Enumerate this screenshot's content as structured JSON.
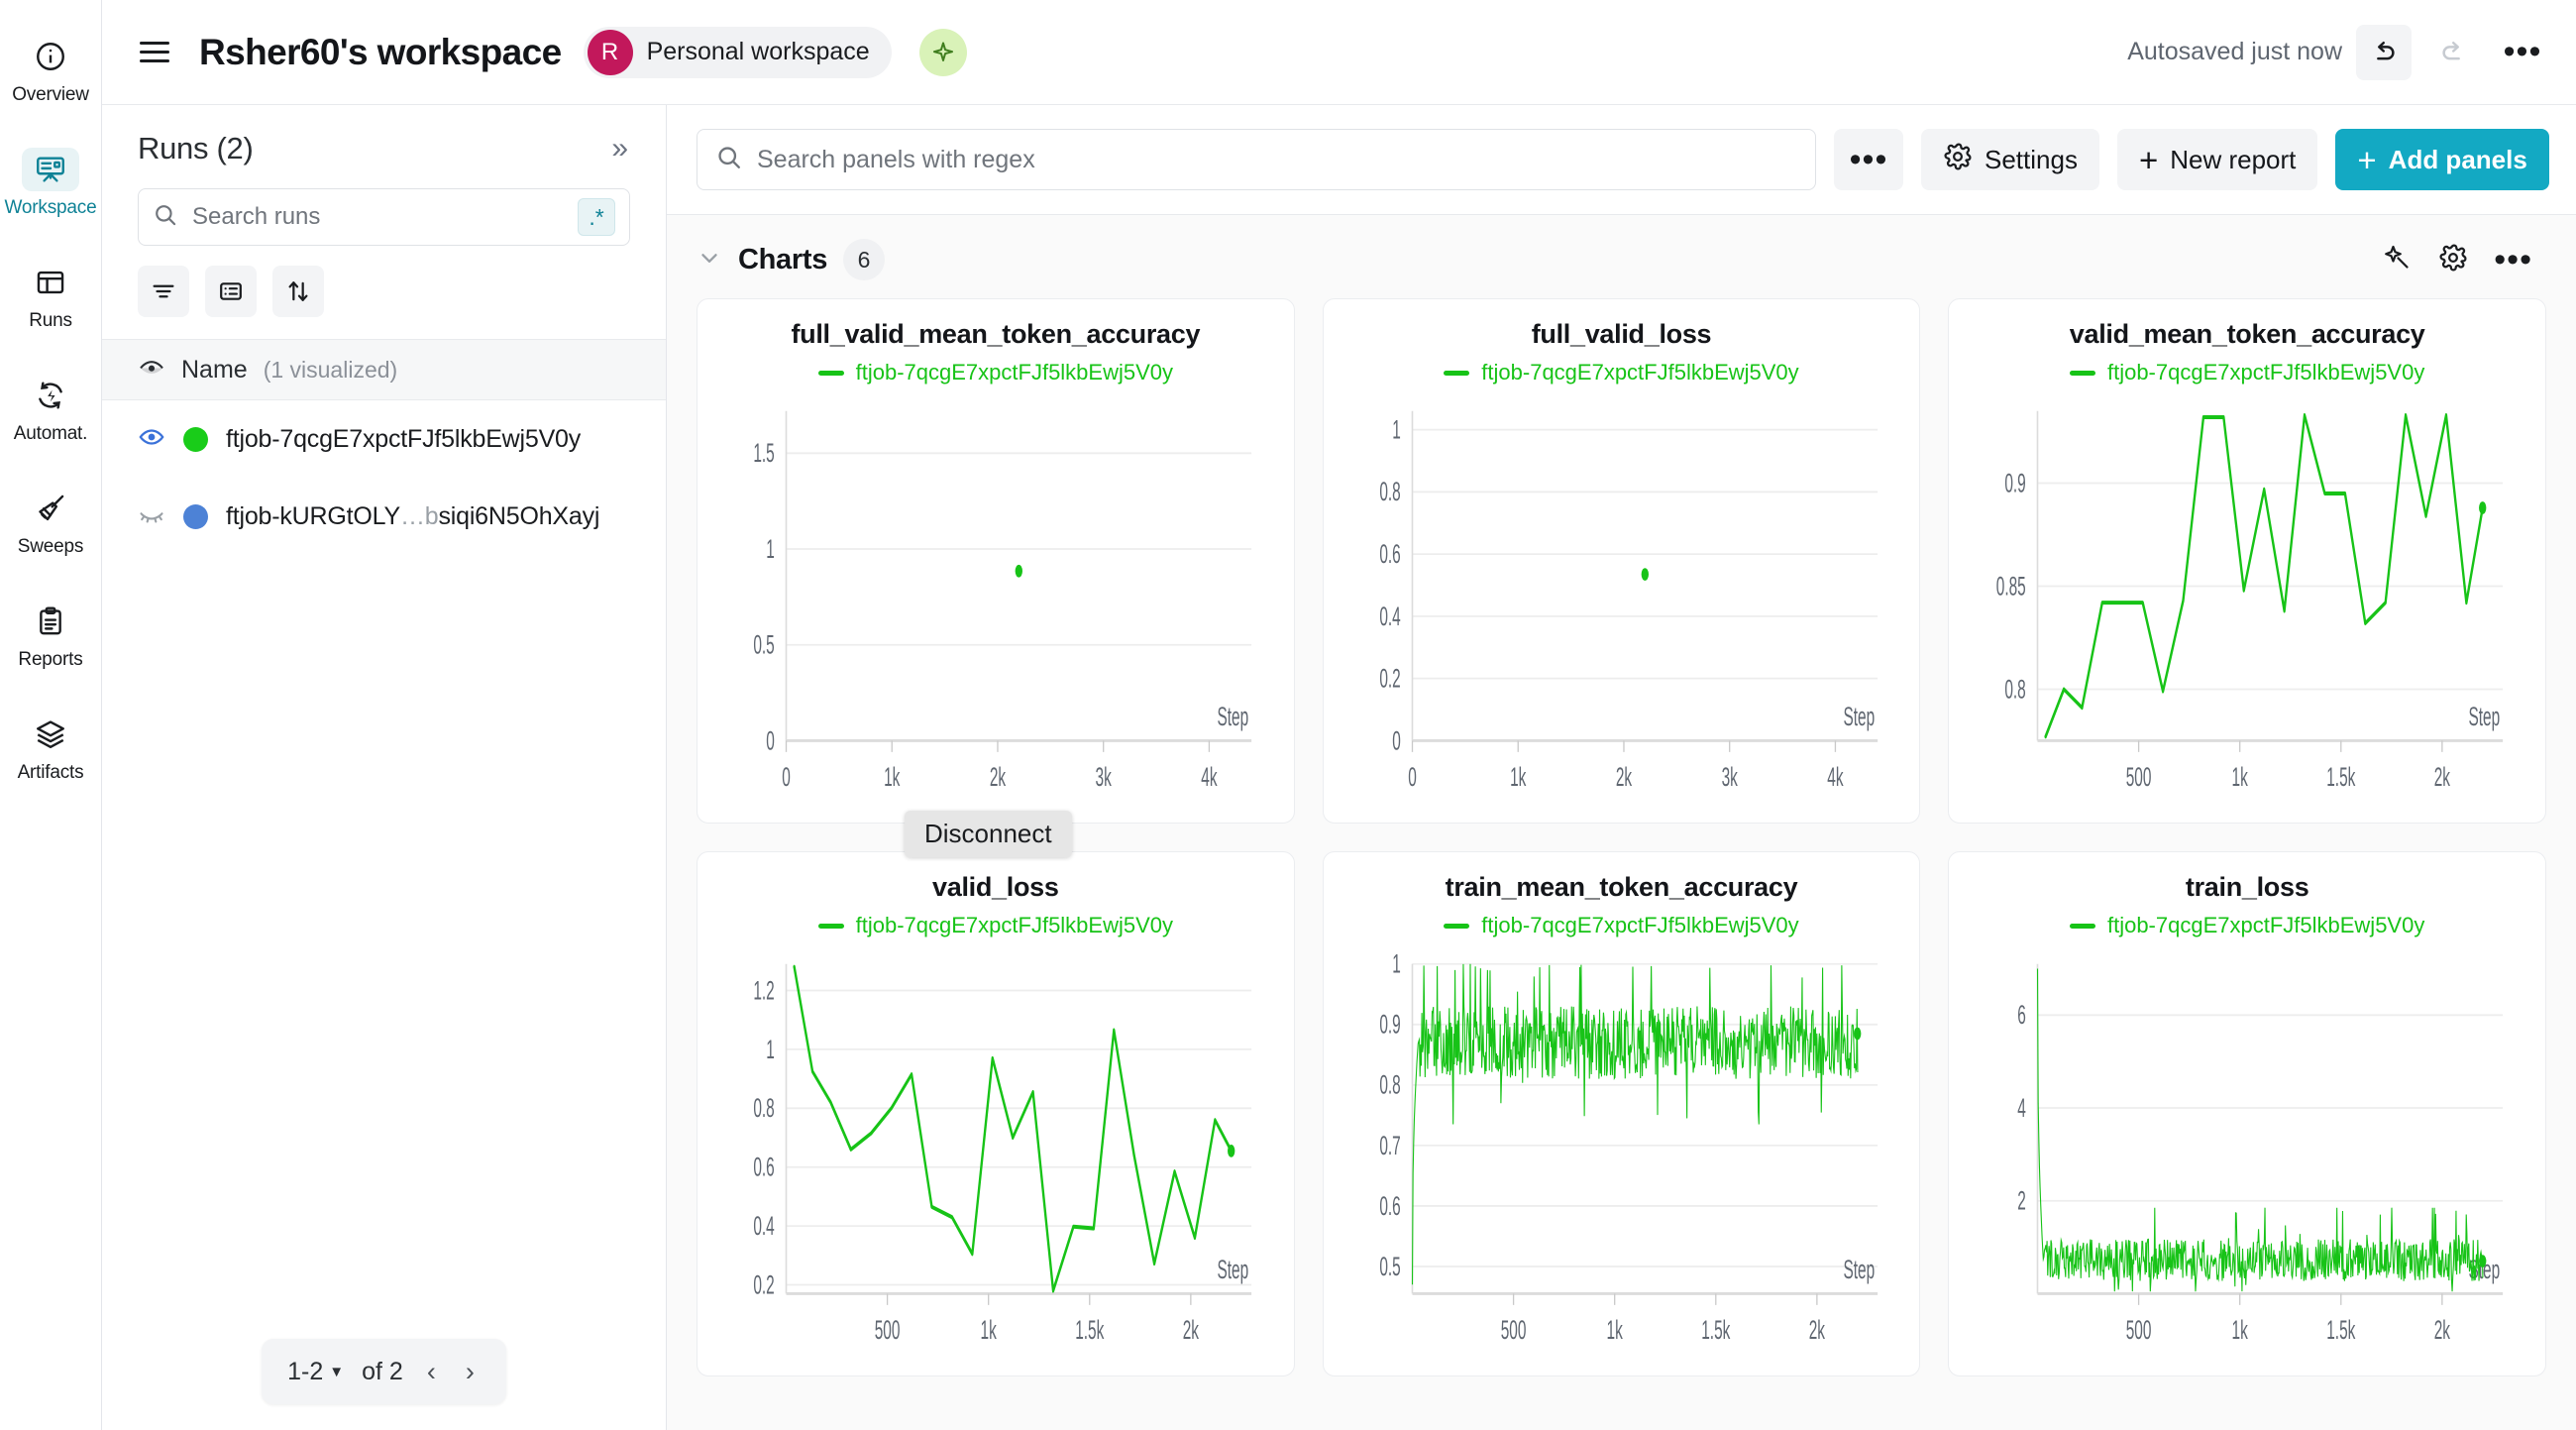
{
  "rail": {
    "items": [
      {
        "label": "Overview",
        "icon": "info-circle-icon",
        "active": false
      },
      {
        "label": "Workspace",
        "icon": "workspace-board-icon",
        "active": true
      },
      {
        "label": "Runs",
        "icon": "table-icon",
        "active": false
      },
      {
        "label": "Automat.",
        "icon": "automation-icon",
        "active": false
      },
      {
        "label": "Sweeps",
        "icon": "broom-icon",
        "active": false
      },
      {
        "label": "Reports",
        "icon": "clipboard-icon",
        "active": false
      },
      {
        "label": "Artifacts",
        "icon": "layers-icon",
        "active": false
      }
    ]
  },
  "topbar": {
    "title": "Rsher60's workspace",
    "avatar_initial": "R",
    "workspace_chip": "Personal workspace",
    "autosaved": "Autosaved just now",
    "accent_color": "#13a9c3",
    "avatar_color": "#c2185b"
  },
  "runs_panel": {
    "title": "Runs (2)",
    "collapse_label": "»",
    "search_placeholder": "Search runs",
    "regex_chip": ".*",
    "column_header": {
      "name": "Name",
      "visualized": "(1 visualized)"
    },
    "runs": [
      {
        "name": "ftjob-7qcgE7xpctFJf5lkbEwj5V0y",
        "color": "#19cc19",
        "visible": true
      },
      {
        "name": "ftjob-kURGtOLY",
        "name_dim": "…b",
        "name_tail": "siqi6N5OhXayj",
        "color": "#4d82d6",
        "visible": false
      }
    ],
    "pager": {
      "range": "1-2",
      "of": "of 2",
      "prev": "‹",
      "next": "›"
    }
  },
  "panel_toolbar": {
    "search_placeholder": "Search panels with regex",
    "more_label": "•••",
    "settings_label": "Settings",
    "new_report_label": "New report",
    "add_panels_label": "Add panels"
  },
  "section": {
    "title": "Charts",
    "count": "6",
    "chevron": "⌄"
  },
  "tooltip": {
    "text": "Disconnect"
  },
  "chart_data": [
    {
      "type": "scatter",
      "title": "full_valid_mean_token_accuracy",
      "legend": [
        "ftjob-7qcgE7xpctFJf5lkbEwj5V0y"
      ],
      "series_color": "#17c317",
      "xlabel": "Step",
      "ylabel": "",
      "xticks": [
        "0",
        "1k",
        "2k",
        "3k",
        "4k"
      ],
      "xtick_values": [
        0,
        1000,
        2000,
        3000,
        4000
      ],
      "yticks": [
        "0",
        "0.5",
        "1",
        "1.5"
      ],
      "ytick_values": [
        0,
        0.5,
        1,
        1.5
      ],
      "xlim": [
        0,
        4400
      ],
      "ylim": [
        0,
        1.72
      ],
      "grid": true,
      "points": [
        [
          2200,
          0.885
        ]
      ]
    },
    {
      "type": "scatter",
      "title": "full_valid_loss",
      "legend": [
        "ftjob-7qcgE7xpctFJf5lkbEwj5V0y"
      ],
      "series_color": "#17c317",
      "xlabel": "Step",
      "ylabel": "",
      "xticks": [
        "0",
        "1k",
        "2k",
        "3k",
        "4k"
      ],
      "xtick_values": [
        0,
        1000,
        2000,
        3000,
        4000
      ],
      "yticks": [
        "0",
        "0.2",
        "0.4",
        "0.6",
        "0.8",
        "1"
      ],
      "ytick_values": [
        0,
        0.2,
        0.4,
        0.6,
        0.8,
        1
      ],
      "xlim": [
        0,
        4400
      ],
      "ylim": [
        0,
        1.06
      ],
      "grid": true,
      "points": [
        [
          2200,
          0.535
        ]
      ]
    },
    {
      "type": "line",
      "title": "valid_mean_token_accuracy",
      "legend": [
        "ftjob-7qcgE7xpctFJf5lkbEwj5V0y"
      ],
      "series_color": "#17c317",
      "xlabel": "Step",
      "ylabel": "",
      "xticks": [
        "500",
        "1k",
        "1.5k",
        "2k"
      ],
      "xtick_values": [
        500,
        1000,
        1500,
        2000
      ],
      "yticks": [
        "0.8",
        "0.85",
        "0.9"
      ],
      "ytick_values": [
        0.8,
        0.85,
        0.9
      ],
      "xlim": [
        0,
        2300
      ],
      "ylim": [
        0.775,
        0.935
      ],
      "grid": true,
      "x": [
        40,
        130,
        220,
        320,
        420,
        520,
        620,
        720,
        820,
        920,
        1020,
        1120,
        1220,
        1320,
        1420,
        1520,
        1620,
        1720,
        1820,
        1920,
        2020,
        2120,
        2200
      ],
      "values": [
        0.777,
        0.8,
        0.791,
        0.842,
        0.842,
        0.842,
        0.799,
        0.843,
        0.932,
        0.932,
        0.848,
        0.897,
        0.838,
        0.933,
        0.895,
        0.895,
        0.832,
        0.842,
        0.933,
        0.884,
        0.933,
        0.842,
        0.888
      ],
      "endpoint": [
        2200,
        0.888
      ]
    },
    {
      "type": "line",
      "title": "valid_loss",
      "legend": [
        "ftjob-7qcgE7xpctFJf5lkbEwj5V0y"
      ],
      "series_color": "#17c317",
      "xlabel": "Step",
      "ylabel": "",
      "xticks": [
        "500",
        "1k",
        "1.5k",
        "2k"
      ],
      "xtick_values": [
        500,
        1000,
        1500,
        2000
      ],
      "yticks": [
        "0.2",
        "0.4",
        "0.6",
        "0.8",
        "1",
        "1.2"
      ],
      "ytick_values": [
        0.2,
        0.4,
        0.6,
        0.8,
        1.0,
        1.2
      ],
      "xlim": [
        0,
        2300
      ],
      "ylim": [
        0.17,
        1.29
      ],
      "grid": true,
      "x": [
        40,
        130,
        220,
        320,
        420,
        520,
        620,
        720,
        820,
        920,
        1020,
        1120,
        1220,
        1320,
        1420,
        1520,
        1620,
        1720,
        1820,
        1920,
        2020,
        2120,
        2200
      ],
      "values": [
        1.28,
        0.925,
        0.82,
        0.66,
        0.715,
        0.8,
        0.915,
        0.465,
        0.43,
        0.305,
        0.97,
        0.7,
        0.855,
        0.18,
        0.398,
        0.392,
        1.065,
        0.64,
        0.272,
        0.585,
        0.36,
        0.76,
        0.655
      ],
      "endpoint": [
        2200,
        0.655
      ]
    },
    {
      "type": "line",
      "title": "train_mean_token_accuracy",
      "legend": [
        "ftjob-7qcgE7xpctFJf5lkbEwj5V0y"
      ],
      "series_color": "#17c317",
      "xlabel": "Step",
      "ylabel": "",
      "xticks": [
        "500",
        "1k",
        "1.5k",
        "2k"
      ],
      "xtick_values": [
        500,
        1000,
        1500,
        2000
      ],
      "yticks": [
        "0.5",
        "0.6",
        "0.7",
        "0.8",
        "0.9",
        "1"
      ],
      "ytick_values": [
        0.5,
        0.6,
        0.7,
        0.8,
        0.9,
        1
      ],
      "xlim": [
        0,
        2300
      ],
      "ylim": [
        0.455,
        1.0
      ],
      "grid": true,
      "noise_band": {
        "start_value": 0.47,
        "rise_end_step": 30,
        "mean": 0.87,
        "min": 0.735,
        "max": 1.0,
        "samples": 700
      },
      "endpoint": [
        2200,
        0.885
      ]
    },
    {
      "type": "line",
      "title": "train_loss",
      "legend": [
        "ftjob-7qcgE7xpctFJf5lkbEwj5V0y"
      ],
      "series_color": "#17c317",
      "xlabel": "Step",
      "ylabel": "",
      "xticks": [
        "500",
        "1k",
        "1.5k",
        "2k"
      ],
      "xtick_values": [
        500,
        1000,
        1500,
        2000
      ],
      "yticks": [
        "2",
        "4",
        "6"
      ],
      "ytick_values": [
        2,
        4,
        6
      ],
      "xlim": [
        0,
        2300
      ],
      "ylim": [
        0,
        7.1
      ],
      "grid": true,
      "noise_band": {
        "start_value": 7.0,
        "decay_end_step": 30,
        "mean": 0.72,
        "min": 0.05,
        "max": 1.85,
        "samples": 700
      },
      "endpoint": [
        2200,
        0.7
      ]
    }
  ]
}
